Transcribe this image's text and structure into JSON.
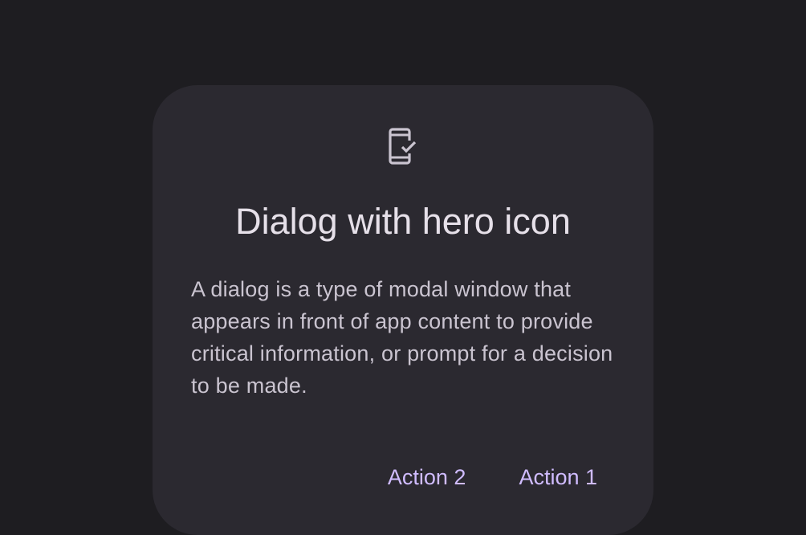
{
  "dialog": {
    "hero_icon": "mobile-check-icon",
    "title": "Dialog with hero icon",
    "body": "A dialog is a type of modal window that appears in front of app content to provide critical information, or prompt for a decision to be made.",
    "actions": [
      {
        "label": "Action 2"
      },
      {
        "label": "Action 1"
      }
    ]
  },
  "colors": {
    "background": "#1e1d21",
    "surface": "#2b2930",
    "on_surface": "#e6e0e9",
    "on_surface_variant": "#cac4d0",
    "primary": "#d0bcff"
  }
}
